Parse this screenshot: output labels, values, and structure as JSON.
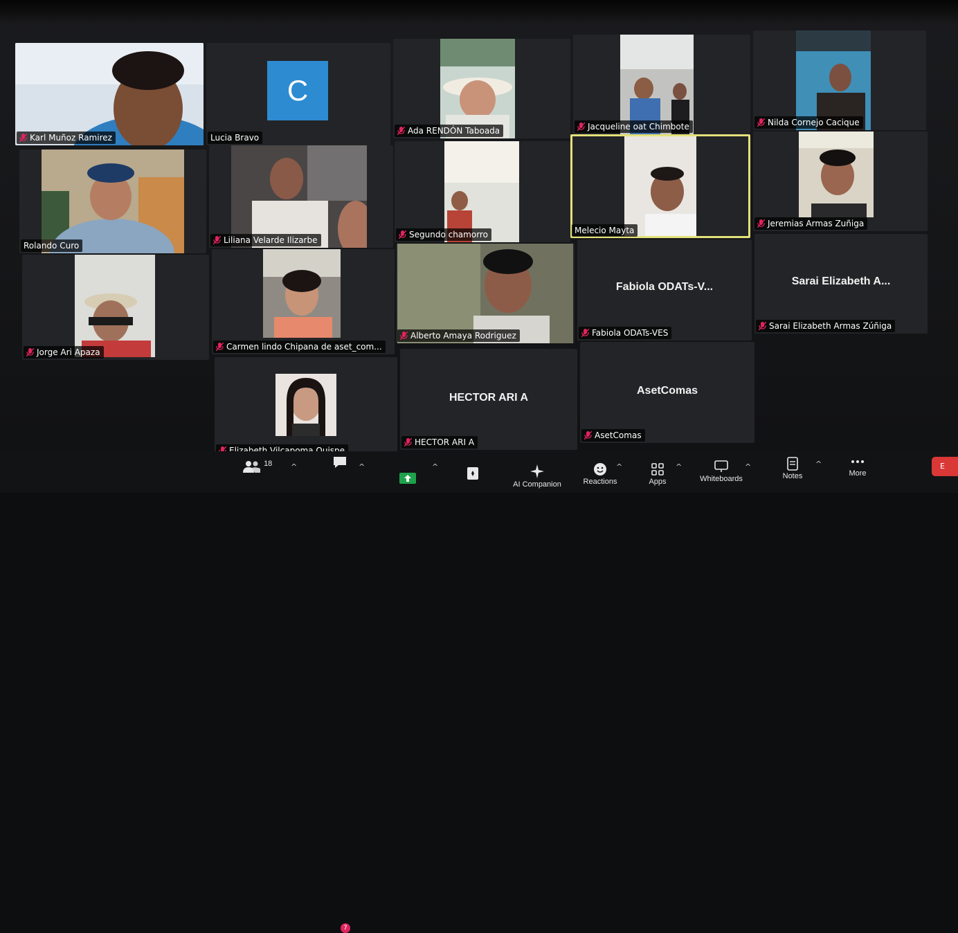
{
  "participants": [
    {
      "id": "p1",
      "name": "Karl Muñoz Ramirez",
      "muted": true
    },
    {
      "id": "p2",
      "name": "Lucia Bravo",
      "muted": false,
      "avatar_letter": "C"
    },
    {
      "id": "p3",
      "name": "Ada RENDÓN Taboada",
      "muted": true
    },
    {
      "id": "p4",
      "name": "Jacqueline oat Chimbote",
      "muted": true
    },
    {
      "id": "p5",
      "name": "Nilda Cornejo Cacique",
      "muted": true
    },
    {
      "id": "p6",
      "name": "Rolando Curo",
      "muted": false
    },
    {
      "id": "p7",
      "name": "Liliana Velarde Ilizarbe",
      "muted": true
    },
    {
      "id": "p8",
      "name": "Segundo chamorro",
      "muted": true
    },
    {
      "id": "p9",
      "name": "Melecio Mayta",
      "muted": false,
      "active_speaker": true
    },
    {
      "id": "p10",
      "name": "Jeremias Armas Zuñiga",
      "muted": true
    },
    {
      "id": "p11",
      "name": "Jorge Ari Apaza",
      "muted": true
    },
    {
      "id": "p12",
      "name": "Carmen lindo Chipana de aset_com...",
      "muted": true
    },
    {
      "id": "p13",
      "name": "Alberto Amaya Rodriguez",
      "muted": true
    },
    {
      "id": "p14",
      "name": "Fabiola ODATs-VES",
      "display_name": "Fabiola  ODATs-V...",
      "muted": true
    },
    {
      "id": "p15",
      "name": "Sarai Elizabeth Armas Zúñiga",
      "display_name": "Sarai Elizabeth A...",
      "muted": true
    },
    {
      "id": "p16",
      "name": "Elizabeth Vilcapoma Quispe",
      "muted": true
    },
    {
      "id": "p17",
      "name": "HECTOR ARI  A",
      "display_name": "HECTOR ARI  A",
      "muted": true
    },
    {
      "id": "p18",
      "name": "AsetComas",
      "display_name": "AsetComas",
      "muted": true
    }
  ],
  "toolbar": {
    "participants_count": "18",
    "chat_badge": "7",
    "items": {
      "ai_companion": "AI Companion",
      "reactions": "Reactions",
      "apps": "Apps",
      "whiteboards": "Whiteboards",
      "notes": "Notes",
      "more": "More"
    },
    "end_label": "E"
  },
  "colors": {
    "active_border": "#e3e17a",
    "muted_icon": "#e0245e",
    "avatar_bg": "#2d8bd1",
    "share_green": "#1fa14b"
  }
}
